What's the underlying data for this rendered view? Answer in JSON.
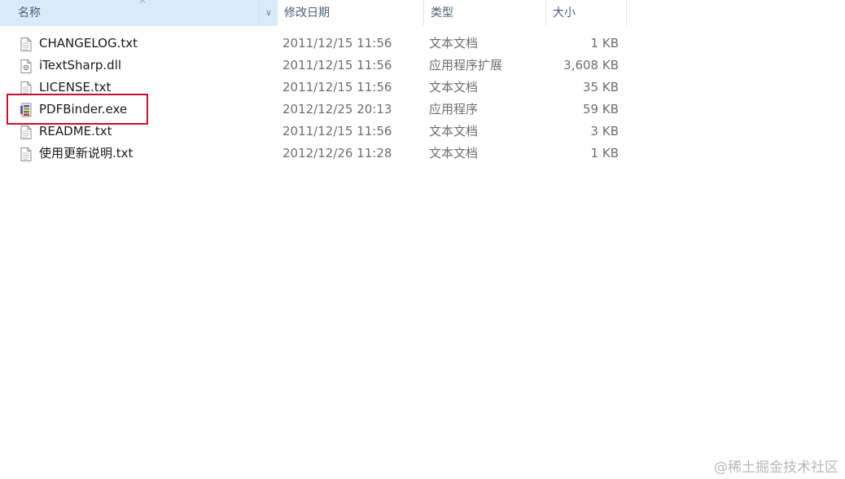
{
  "columns": {
    "name": "名称",
    "modified": "修改日期",
    "type": "类型",
    "size": "大小"
  },
  "files": [
    {
      "name": "CHANGELOG.txt",
      "modified": "2011/12/15 11:56",
      "type": "文本文档",
      "size": "1 KB",
      "icon": "text-file-icon"
    },
    {
      "name": "iTextSharp.dll",
      "modified": "2011/12/15 11:56",
      "type": "应用程序扩展",
      "size": "3,608 KB",
      "icon": "dll-file-icon"
    },
    {
      "name": "LICENSE.txt",
      "modified": "2011/12/15 11:56",
      "type": "文本文档",
      "size": "35 KB",
      "icon": "text-file-icon"
    },
    {
      "name": "PDFBinder.exe",
      "modified": "2012/12/25 20:13",
      "type": "应用程序",
      "size": "59 KB",
      "icon": "exe-app-icon"
    },
    {
      "name": "README.txt",
      "modified": "2011/12/15 11:56",
      "type": "文本文档",
      "size": "3 KB",
      "icon": "text-file-icon"
    },
    {
      "name": "使用更新说明.txt",
      "modified": "2012/12/26 11:28",
      "type": "文本文档",
      "size": "1 KB",
      "icon": "text-file-icon"
    }
  ],
  "watermark": "@稀土掘金技术社区",
  "colors": {
    "header_selected": "#d9ebf9",
    "highlight": "#c8102e"
  }
}
